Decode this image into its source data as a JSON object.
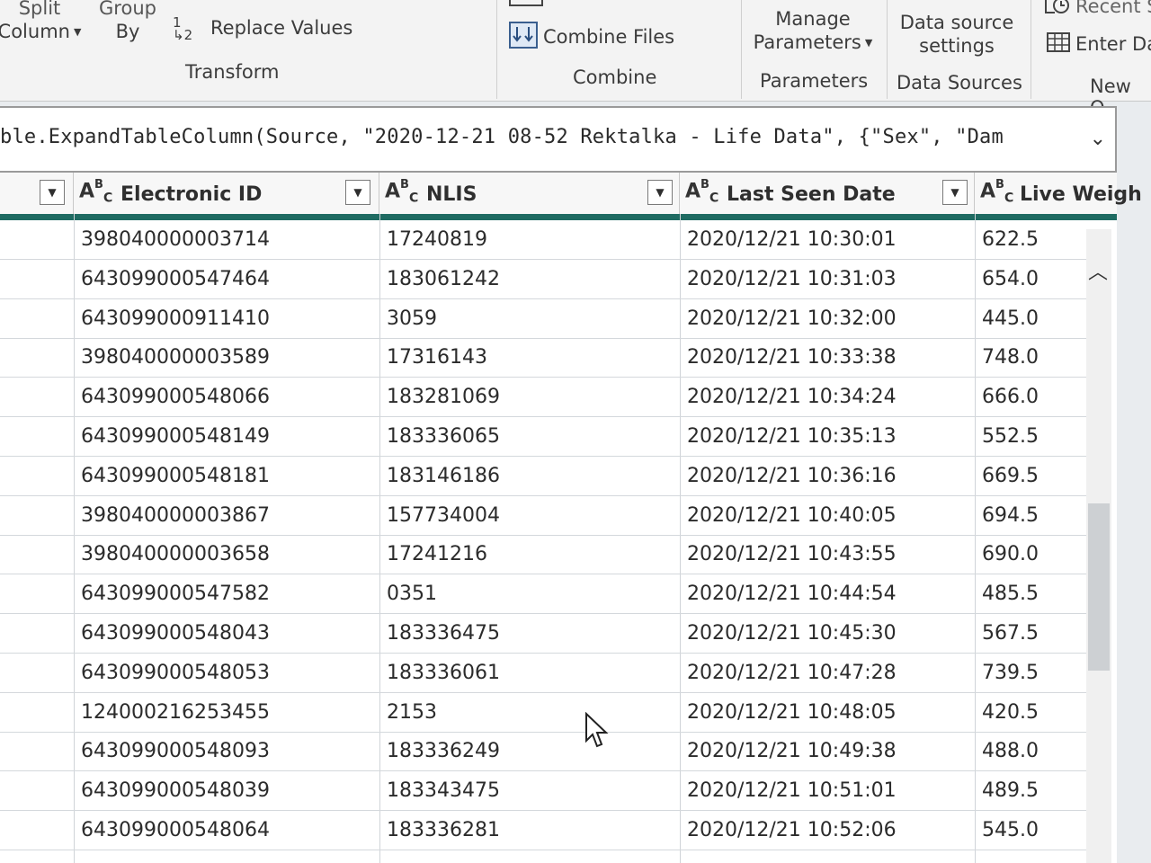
{
  "ribbon": {
    "split_column": [
      "Split",
      "Column"
    ],
    "group_by": [
      "Group",
      "By"
    ],
    "replace_values": "Replace Values",
    "transform_label": "Transform",
    "combine_files": "Combine Files",
    "combine_label": "Combine",
    "manage_parameters": [
      "Manage",
      "Parameters"
    ],
    "parameters_label": "Parameters",
    "data_source_settings": [
      "Data source",
      "settings"
    ],
    "data_sources_label": "Data Sources",
    "recent": "Recent S",
    "enter_data": "Enter Da",
    "new_query_label": "New Q"
  },
  "formula": {
    "text": "ble.ExpandTableColumn(Source, \"2020-12-21 08-52 Rektalka - Life Data\", {\"Sex\", \"Dam"
  },
  "columns": [
    "Electronic ID",
    "NLIS",
    "Last Seen Date",
    "Live Weigh"
  ],
  "rows": [
    [
      "398040000003714",
      "17240819",
      "2020/12/21 10:30:01",
      "622.5"
    ],
    [
      "643099000547464",
      "183061242",
      "2020/12/21 10:31:03",
      "654.0"
    ],
    [
      "643099000911410",
      "3059",
      "2020/12/21 10:32:00",
      "445.0"
    ],
    [
      "398040000003589",
      "17316143",
      "2020/12/21 10:33:38",
      "748.0"
    ],
    [
      "643099000548066",
      "183281069",
      "2020/12/21 10:34:24",
      "666.0"
    ],
    [
      "643099000548149",
      "183336065",
      "2020/12/21 10:35:13",
      "552.5"
    ],
    [
      "643099000548181",
      "183146186",
      "2020/12/21 10:36:16",
      "669.5"
    ],
    [
      "398040000003867",
      "157734004",
      "2020/12/21 10:40:05",
      "694.5"
    ],
    [
      "398040000003658",
      "17241216",
      "2020/12/21 10:43:55",
      "690.0"
    ],
    [
      "643099000547582",
      "0351",
      "2020/12/21 10:44:54",
      "485.5"
    ],
    [
      "643099000548043",
      "183336475",
      "2020/12/21 10:45:30",
      "567.5"
    ],
    [
      "643099000548053",
      "183336061",
      "2020/12/21 10:47:28",
      "739.5"
    ],
    [
      "124000216253455",
      "2153",
      "2020/12/21 10:48:05",
      "420.5"
    ],
    [
      "643099000548093",
      "183336249",
      "2020/12/21 10:49:38",
      "488.0"
    ],
    [
      "643099000548039",
      "183343475",
      "2020/12/21 10:51:01",
      "489.5"
    ],
    [
      "643099000548064",
      "183336281",
      "2020/12/21 10:52:06",
      "545.0"
    ]
  ],
  "colors": {
    "accent": "#1f6b62",
    "header_bg": "#f7f7f7"
  }
}
